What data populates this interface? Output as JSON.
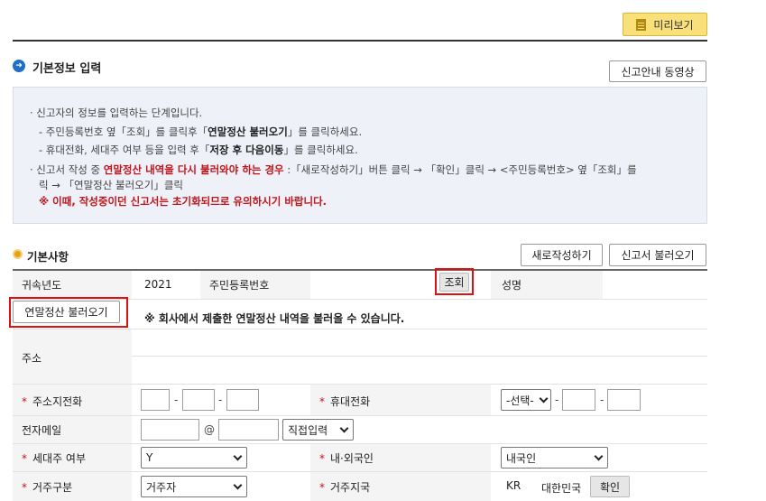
{
  "toolbar": {
    "preview_label": "미리보기"
  },
  "section_basic_info": {
    "title": "기본정보 입력",
    "video_button": "신고안내 동영상"
  },
  "info": {
    "line1": "· 신고자의 정보를 입력하는 단계입니다.",
    "line2_pre": "- 주민등록번호 옆「조회」를 클릭후「",
    "line2_bold": "연말정산 불러오기",
    "line2_post": "」를 클릭하세요.",
    "line3_pre": "- 휴대전화, 세대주 여부 등을 입력 후「",
    "line3_bold": "저장 후 다음이동",
    "line3_post": "」를 클릭하세요.",
    "line4_pre": "· 신고서 작성 중 ",
    "line4_red": "연말정산 내역을 다시 불러와야 하는 경우",
    "line4_post": " :「새로작성하기」버튼 클릭 → 「확인」클릭 → <주민등록번호> 옆「조회」를",
    "line5": "릭 → 「연말정산 불러오기」클릭",
    "line6": "※ 이때, 작성중이던 신고서는 초기화되므로 유의하시기 바랍니다."
  },
  "section_basic": {
    "title": "기본사항",
    "new_button": "새로작성하기",
    "load_button": "신고서 불러오기"
  },
  "form": {
    "year_label": "귀속년도",
    "year_value": "2021",
    "rrn_label": "주민등록번호",
    "lookup_button": "조회",
    "name_label": "성명",
    "load_settlement_button": "연말정산 불러오기",
    "settlement_notice": "※ 회사에서 제출한 연말정산 내역을 불러올 수 있습니다.",
    "address_label": "주소",
    "home_phone_label": "주소지전화",
    "mobile_label": "휴대전화",
    "mobile_select": "-선택-",
    "email_label": "전자메일",
    "email_at": "@",
    "email_domain_select": "직접입력",
    "householder_label": "세대주 여부",
    "householder_value": "Y",
    "nationality_label": "내·외국인",
    "nationality_value": "내국인",
    "residence_label": "거주구분",
    "residence_value": "거주자",
    "residence_area_label": "거주지국",
    "country_code": "KR",
    "country_name": "대한민국",
    "confirm_button": "확인"
  }
}
